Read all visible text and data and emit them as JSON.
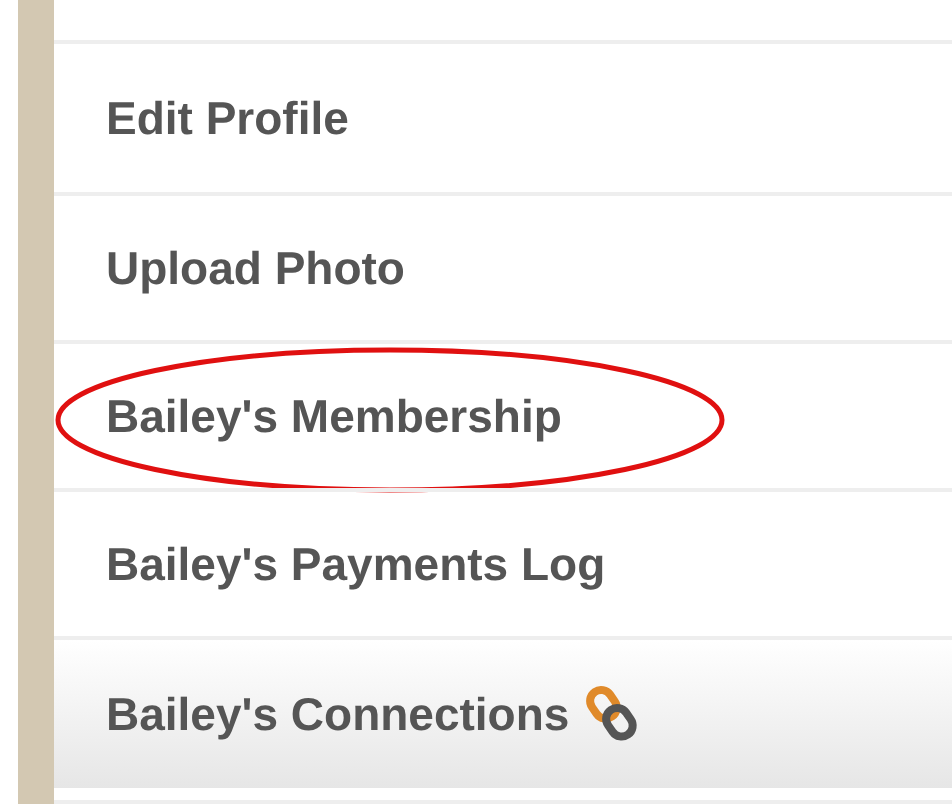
{
  "menu": {
    "items": [
      {
        "label": "Edit Profile",
        "selected": false,
        "circled": false,
        "kind": "plain"
      },
      {
        "label": "Upload Photo",
        "selected": false,
        "circled": false,
        "kind": "plain"
      },
      {
        "label": "Bailey's Membership",
        "selected": false,
        "circled": true,
        "kind": "plain"
      },
      {
        "label": "Bailey's Payments Log",
        "selected": false,
        "circled": false,
        "kind": "plain"
      },
      {
        "label": "Bailey's Connections",
        "selected": true,
        "circled": false,
        "kind": "linked"
      }
    ]
  }
}
